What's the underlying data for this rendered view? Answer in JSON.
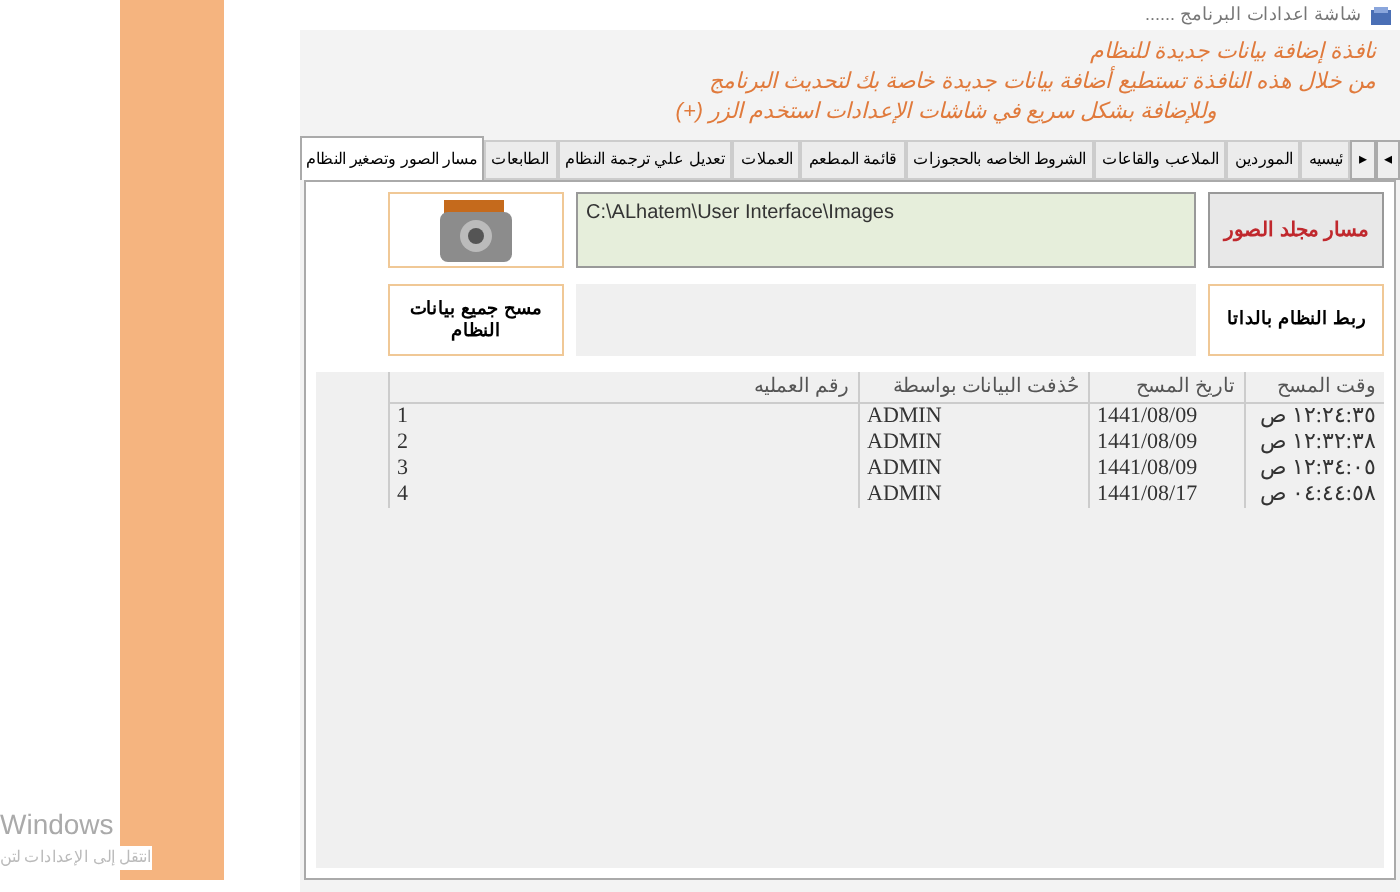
{
  "window": {
    "title": "شاشة اعدادات البرنامج ......"
  },
  "header": {
    "lines": [
      "نافذة إضافة بيانات جديدة للنظام",
      "من خلال هذه النافذة تستطيع أضافة بيانات جديدة خاصة بك لتحديث البرنامج",
      "وللإضافة بشكل سريع في شاشات الإعدادات استخدم الزر (+)"
    ]
  },
  "tab_scroll": [
    "◂",
    "▸"
  ],
  "tabs": [
    {
      "label": "ئيسيه",
      "selected": false
    },
    {
      "label": "الموردين",
      "selected": false
    },
    {
      "label": "الملاعب والقاعات",
      "selected": false
    },
    {
      "label": "الشروط الخاصه بالحجوزات",
      "selected": false
    },
    {
      "label": "قائمة المطعم",
      "selected": false
    },
    {
      "label": "العملات",
      "selected": false
    },
    {
      "label": "تعديل علي ترجمة النظام",
      "selected": false
    },
    {
      "label": "الطابعات",
      "selected": false
    },
    {
      "label": "مسار الصور وتصغير النظام",
      "selected": true
    }
  ],
  "images_path": {
    "button": "مسار مجلد الصور",
    "value": "C:\\ALhatem\\User Interface\\Images"
  },
  "link_button": "ربط النظام بالداتا",
  "wipe_button": "مسح جميع بيانات النظام",
  "table": {
    "columns": [
      "وقت المسح",
      "تاريخ  المسح",
      "حُذفت البيانات بواسطة",
      "رقم العمليه"
    ],
    "rows": [
      [
        "١٢:٢٤:٣٥ ص",
        "1441/08/09",
        "ADMIN",
        "1"
      ],
      [
        "١٢:٣٢:٣٨ ص",
        "1441/08/09",
        "ADMIN",
        "2"
      ],
      [
        "١٢:٣٤:٠٥ ص",
        "1441/08/09",
        "ADMIN",
        "3"
      ],
      [
        "٠٤:٤٤:٥٨ ص",
        "1441/08/17",
        "ADMIN",
        "4"
      ]
    ]
  },
  "desktop_notice": [
    "Windows",
    "انتقل إلى الإعدادات لتن"
  ]
}
